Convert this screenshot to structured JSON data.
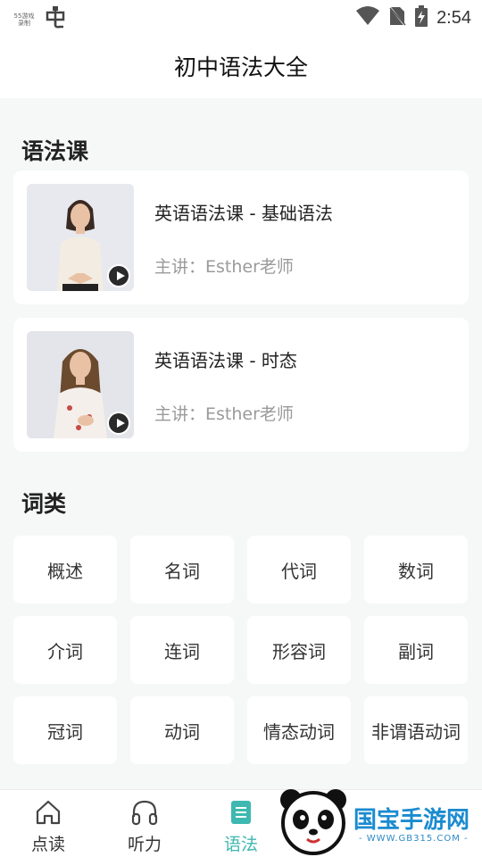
{
  "status_bar": {
    "logo_text": [
      "55游戏",
      "录制"
    ],
    "time": "2:54"
  },
  "header": {
    "title": "初中语法大全"
  },
  "grammar_section": {
    "title": "语法课",
    "courses": [
      {
        "name": "英语语法课 - 基础语法",
        "teacher": "主讲：Esther老师"
      },
      {
        "name": "英语语法课 - 时态",
        "teacher": "主讲：Esther老师"
      }
    ]
  },
  "word_class_section": {
    "title": "词类",
    "items": [
      "概述",
      "名词",
      "代词",
      "数词",
      "介词",
      "连词",
      "形容词",
      "副词",
      "冠词",
      "动词",
      "情态动词",
      "非谓语动词"
    ]
  },
  "tab_bar": {
    "tabs": [
      {
        "label": "点读",
        "icon": "home-icon"
      },
      {
        "label": "听力",
        "icon": "headphones-icon"
      },
      {
        "label": "语法",
        "icon": "list-icon",
        "active": true
      }
    ],
    "active_color": "#3eb8b0"
  },
  "watermark": {
    "text": "国宝手游网",
    "url": "- WWW.GB315.COM -"
  }
}
